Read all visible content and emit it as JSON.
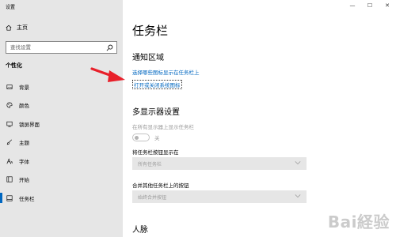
{
  "window": {
    "title": "设置",
    "controls": [
      "—",
      "☐",
      "✕"
    ]
  },
  "sidebar": {
    "home_label": "主页",
    "search_placeholder": "查找设置",
    "section": "个性化",
    "items": [
      {
        "label": "背景",
        "icon": "image-icon"
      },
      {
        "label": "颜色",
        "icon": "palette-icon"
      },
      {
        "label": "锁屏界面",
        "icon": "lockscreen-icon"
      },
      {
        "label": "主题",
        "icon": "theme-brush-icon"
      },
      {
        "label": "字体",
        "icon": "font-icon"
      },
      {
        "label": "开始",
        "icon": "start-icon"
      },
      {
        "label": "任务栏",
        "icon": "taskbar-icon",
        "active": true
      }
    ]
  },
  "main": {
    "title": "任务栏",
    "notification_area": {
      "heading": "通知区域",
      "link1": "选择哪些图标显示在任务栏上",
      "link2": "打开或关闭系统图标"
    },
    "multi_display": {
      "heading": "多显示器设置",
      "show_all_label": "在所有显示器上显示任务栏",
      "toggle_state": "关",
      "show_buttons_label": "将任务栏按钮显示在",
      "show_buttons_value": "所有任务栏",
      "combine_label": "合并其他任务栏上的按钮",
      "combine_value": "始终合并按钮"
    },
    "people_heading": "人脉"
  },
  "colors": {
    "accent": "#0067c0",
    "annotation_arrow": "#e8202a"
  },
  "watermark": "Bai経验"
}
